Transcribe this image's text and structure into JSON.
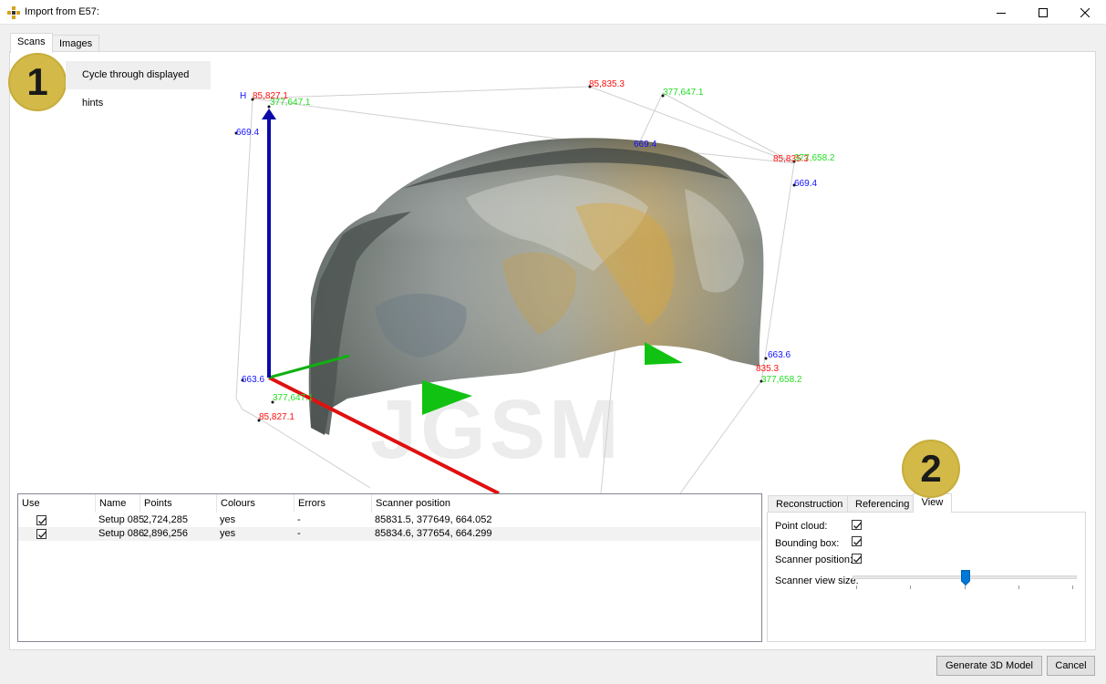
{
  "window": {
    "title": "Import from E57:",
    "icon": "app-cross-icon"
  },
  "tabs": [
    {
      "label": "Scans",
      "active": true
    },
    {
      "label": "Images",
      "active": false
    }
  ],
  "hints": {
    "badge1": "1",
    "badge2": "2",
    "cycle_label": "Cycle through displayed hints"
  },
  "viewer": {
    "watermark": "JGSM",
    "axis_label_h": "H",
    "labels": {
      "red_tl": "85,827.1",
      "green_tl": "377,647.1",
      "blue_ul": "669.4",
      "red_top": "85,835.3",
      "green_top_r": "377,647.1",
      "blue_top_mid": "669.4",
      "red_right": "85,835.3",
      "green_right": "377,658.2",
      "blue_right": "669.4",
      "blue_bl": "663.6",
      "green_bl": "377,647.1",
      "red_bl": "85,827.1",
      "blue_br": "663.6",
      "red_br": "835.3",
      "green_br": "377,658.2"
    },
    "colors": {
      "red": "#ff0000",
      "green": "#27d927",
      "blue": "#1010ff"
    }
  },
  "scans_table": {
    "columns": [
      "Use",
      "Name",
      "Points",
      "Colours",
      "Errors",
      "Scanner position"
    ],
    "rows": [
      {
        "use": true,
        "name": "Setup 085",
        "points": "2,724,285",
        "colours": "yes",
        "errors": "-",
        "position": "85831.5, 377649, 664.052"
      },
      {
        "use": true,
        "name": "Setup 086",
        "points": "2,896,256",
        "colours": "yes",
        "errors": "-",
        "position": "85834.6, 377654, 664.299"
      }
    ]
  },
  "right_tabs": [
    {
      "label": "Reconstruction",
      "active": false
    },
    {
      "label": "Referencing",
      "active": false
    },
    {
      "label": "View",
      "active": true
    }
  ],
  "view_options": {
    "point_cloud_label": "Point cloud:",
    "point_cloud_checked": true,
    "bounding_box_label": "Bounding box:",
    "bounding_box_checked": true,
    "scanner_position_label": "Scanner position:",
    "scanner_position_checked": true,
    "scanner_view_size_label": "Scanner view size:",
    "scanner_view_size_fraction": 0.5
  },
  "buttons": {
    "generate": "Generate 3D Model",
    "cancel": "Cancel"
  },
  "accent": "#0078d7",
  "hint_color": "#d3b947"
}
